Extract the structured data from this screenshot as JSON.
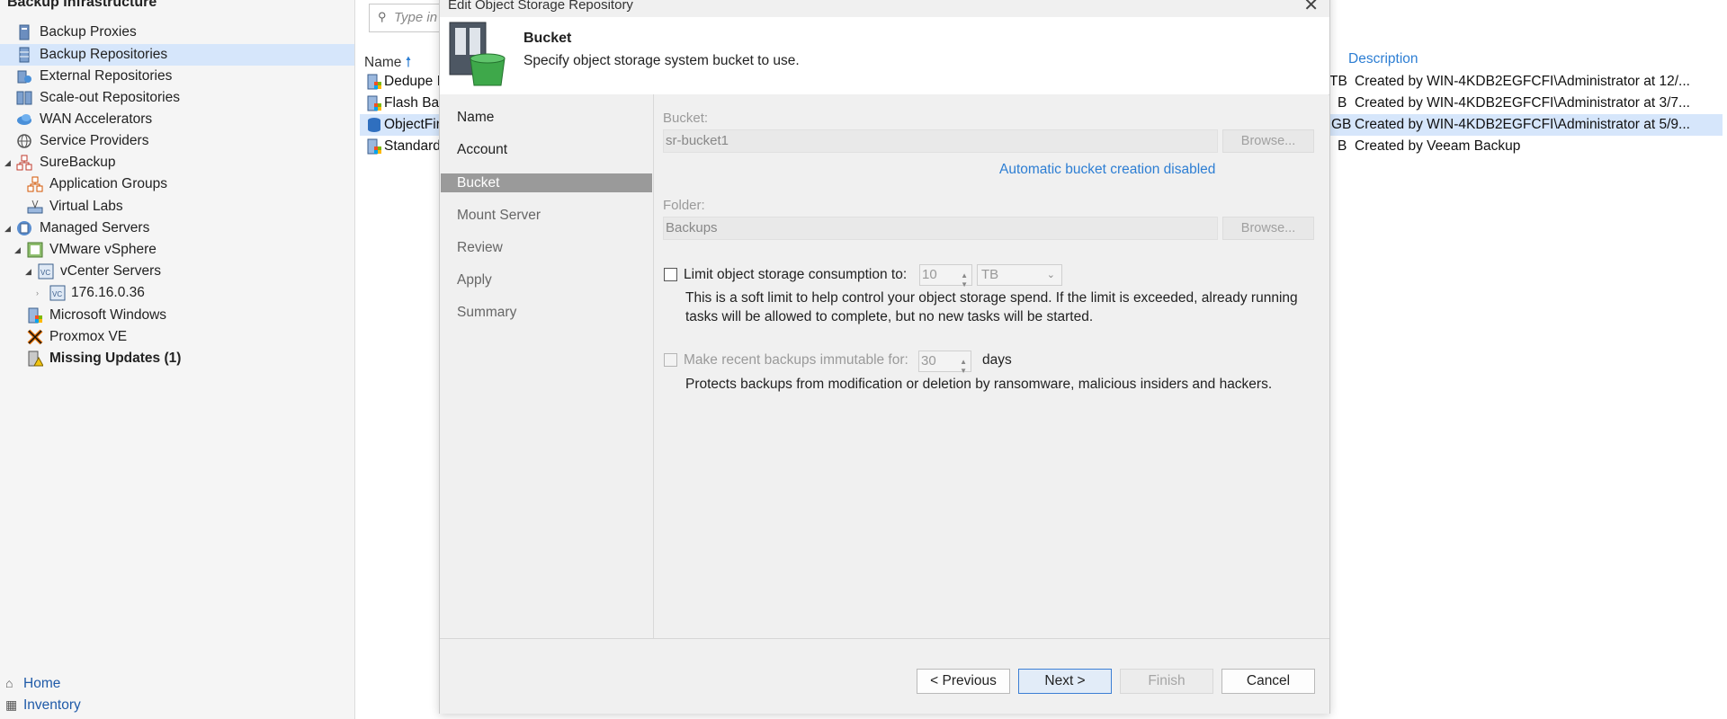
{
  "sidebar": {
    "title": "Backup Infrastructure",
    "items": [
      {
        "label": "Backup Proxies",
        "icon": "proxy-icon"
      },
      {
        "label": "Backup Repositories",
        "icon": "repository-icon"
      },
      {
        "label": "External Repositories",
        "icon": "external-repository-icon"
      },
      {
        "label": "Scale-out Repositories",
        "icon": "scaleout-repository-icon"
      },
      {
        "label": "WAN Accelerators",
        "icon": "wan-accelerator-icon"
      },
      {
        "label": "Service Providers",
        "icon": "service-provider-icon"
      },
      {
        "label": "SureBackup",
        "icon": "surebackup-icon"
      },
      {
        "label": "Application Groups",
        "icon": "application-group-icon"
      },
      {
        "label": "Virtual Labs",
        "icon": "virtual-lab-icon"
      },
      {
        "label": "Managed Servers",
        "icon": "managed-servers-icon"
      },
      {
        "label": "VMware vSphere",
        "icon": "vsphere-icon"
      },
      {
        "label": "vCenter Servers",
        "icon": "vcenter-icon"
      },
      {
        "label": "176.16.0.36",
        "icon": "vcenter-server-icon"
      },
      {
        "label": "Microsoft Windows",
        "icon": "windows-icon"
      },
      {
        "label": "Proxmox VE",
        "icon": "proxmox-icon"
      },
      {
        "label": "Missing Updates (1)",
        "icon": "missing-updates-icon"
      }
    ],
    "bottom_nav": [
      {
        "label": "Home",
        "icon": "home-icon"
      },
      {
        "label": "Inventory",
        "icon": "inventory-icon"
      }
    ]
  },
  "main": {
    "search_placeholder": "Type in",
    "col_name": "Name",
    "col_description": "Description",
    "rows": [
      {
        "name": "Dedupe I",
        "size_suffix": "TB",
        "description": "Created by WIN-4KDB2EGFCFI\\Administrator at 12/..."
      },
      {
        "name": "Flash Bac",
        "size_suffix": "B",
        "description": "Created by WIN-4KDB2EGFCFI\\Administrator at 3/7..."
      },
      {
        "name": "ObjectFir",
        "size_suffix": "GB",
        "description": "Created by WIN-4KDB2EGFCFI\\Administrator at 5/9..."
      },
      {
        "name": "Standard",
        "size_suffix": "B",
        "description": "Created by Veeam Backup"
      }
    ]
  },
  "dialog": {
    "title": "Edit Object Storage Repository",
    "header_title": "Bucket",
    "header_subtitle": "Specify object storage system bucket to use.",
    "steps": [
      "Name",
      "Account",
      "Bucket",
      "Mount Server",
      "Review",
      "Apply",
      "Summary"
    ],
    "active_step": "Bucket",
    "bucket_label": "Bucket:",
    "bucket_value": "sr-bucket1",
    "browse_label": "Browse...",
    "auto_bucket_link": "Automatic bucket creation disabled",
    "folder_label": "Folder:",
    "folder_value": "Backups",
    "limit_label": "Limit object storage consumption to:",
    "limit_value": "10",
    "limit_unit": "TB",
    "limit_help_1": "This is a soft limit to help control your object storage spend. If the limit is exceeded, already running",
    "limit_help_2": "tasks will be allowed to complete, but no new tasks will be started.",
    "immutable_label": "Make recent backups immutable for:",
    "immutable_value": "30",
    "immutable_unit": "days",
    "immutable_help": "Protects backups from modification or deletion by ransomware, malicious insiders and hackers.",
    "buttons": {
      "previous": "< Previous",
      "next": "Next >",
      "finish": "Finish",
      "cancel": "Cancel"
    }
  }
}
